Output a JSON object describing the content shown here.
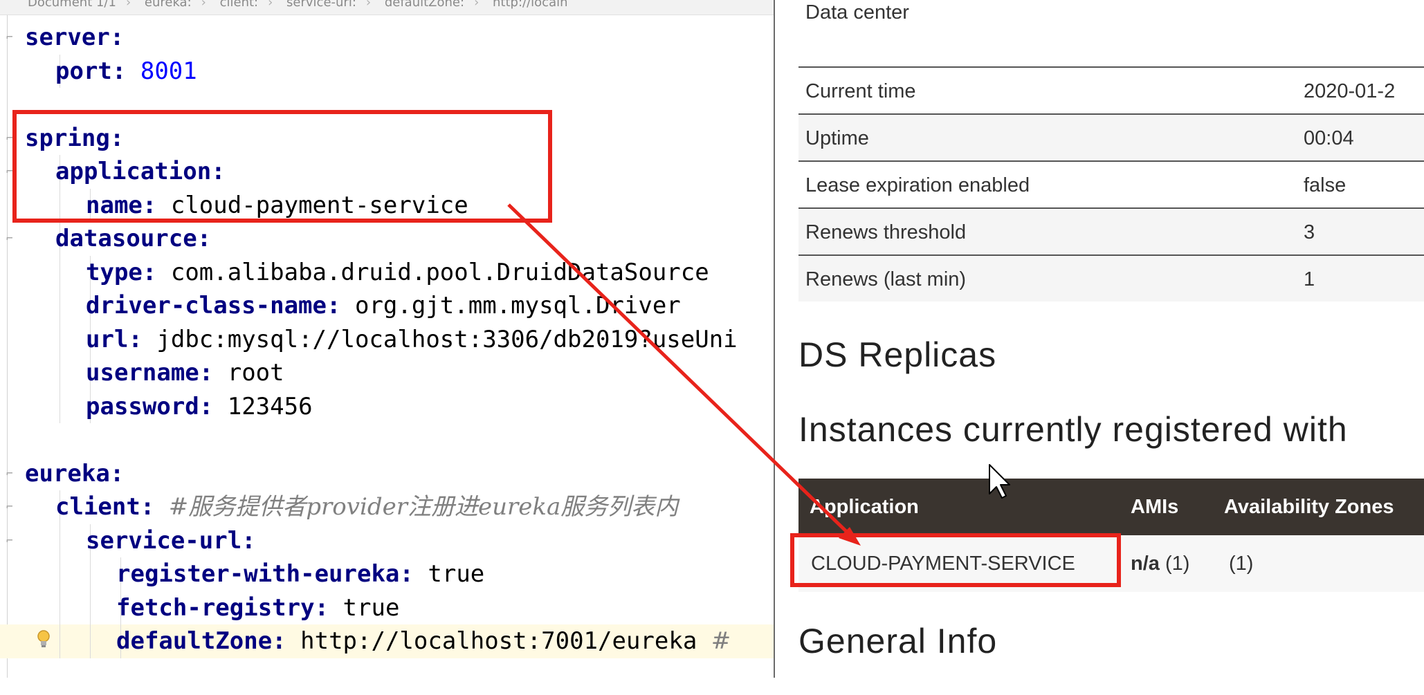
{
  "breadcrumb": [
    "Document 1/1",
    "eureka:",
    "client:",
    "service-url:",
    "defaultZone:",
    "http://localh"
  ],
  "code_lines": [
    {
      "indent": 0,
      "key": "server",
      "value": "",
      "value_kind": "none",
      "comment": ""
    },
    {
      "indent": 1,
      "key": "port",
      "value": "8001",
      "value_kind": "number",
      "comment": ""
    },
    {
      "indent": 0,
      "key": "",
      "value": "",
      "value_kind": "none",
      "comment": ""
    },
    {
      "indent": 0,
      "key": "spring",
      "value": "",
      "value_kind": "none",
      "comment": ""
    },
    {
      "indent": 1,
      "key": "application",
      "value": "",
      "value_kind": "none",
      "comment": ""
    },
    {
      "indent": 2,
      "key": "name",
      "value": "cloud-payment-service",
      "value_kind": "string",
      "comment": ""
    },
    {
      "indent": 1,
      "key": "datasource",
      "value": "",
      "value_kind": "none",
      "comment": ""
    },
    {
      "indent": 2,
      "key": "type",
      "value": "com.alibaba.druid.pool.DruidDataSource",
      "value_kind": "string",
      "comment": ""
    },
    {
      "indent": 2,
      "key": "driver-class-name",
      "value": "org.gjt.mm.mysql.Driver",
      "value_kind": "string",
      "comment": ""
    },
    {
      "indent": 2,
      "key": "url",
      "value": "jdbc:mysql://localhost:3306/db2019?useUni",
      "value_kind": "string",
      "comment": ""
    },
    {
      "indent": 2,
      "key": "username",
      "value": "root",
      "value_kind": "string",
      "comment": ""
    },
    {
      "indent": 2,
      "key": "password",
      "value": "123456",
      "value_kind": "string",
      "comment": ""
    },
    {
      "indent": 0,
      "key": "",
      "value": "",
      "value_kind": "none",
      "comment": ""
    },
    {
      "indent": 0,
      "key": "eureka",
      "value": "",
      "value_kind": "none",
      "comment": ""
    },
    {
      "indent": 1,
      "key": "client",
      "value": "",
      "value_kind": "none",
      "comment": "#服务提供者provider注册进eureka服务列表内"
    },
    {
      "indent": 2,
      "key": "service-url",
      "value": "",
      "value_kind": "none",
      "comment": ""
    },
    {
      "indent": 3,
      "key": "register-with-eureka",
      "value": "true",
      "value_kind": "string",
      "comment": ""
    },
    {
      "indent": 3,
      "key": "fetch-registry",
      "value": "true",
      "value_kind": "string",
      "comment": ""
    },
    {
      "indent": 3,
      "key": "defaultZone",
      "value": "http://localhost:7001/eureka",
      "value_kind": "string",
      "comment": "#",
      "highlighted": true
    }
  ],
  "eureka": {
    "data_center_label": "Data center",
    "info_rows": [
      {
        "key": "Current time",
        "value": "2020-01-2"
      },
      {
        "key": "Uptime",
        "value": "00:04"
      },
      {
        "key": "Lease expiration enabled",
        "value": "false"
      },
      {
        "key": "Renews threshold",
        "value": "3"
      },
      {
        "key": "Renews (last min)",
        "value": "1"
      }
    ],
    "ds_replicas_title": "DS Replicas",
    "instances_title": "Instances currently registered with",
    "instances_headers": {
      "application": "Application",
      "amis": "AMIs",
      "zones": "Availability Zones"
    },
    "instance": {
      "application": "CLOUD-PAYMENT-SERVICE",
      "amis_value": "n/a",
      "amis_count": "(1)",
      "zones": "(1)"
    },
    "general_info_title": "General Info"
  },
  "colors": {
    "yaml_key": "#000080",
    "yaml_number": "#0000ff",
    "comment": "#808080",
    "annotation_red": "#e8231b",
    "table_header_bg": "#3a342f",
    "highlight_line": "#fffae3"
  },
  "icons": {
    "fold_marker": "fold-icon",
    "intention_bulb": "lightbulb-icon",
    "mouse_cursor": "cursor-icon"
  }
}
